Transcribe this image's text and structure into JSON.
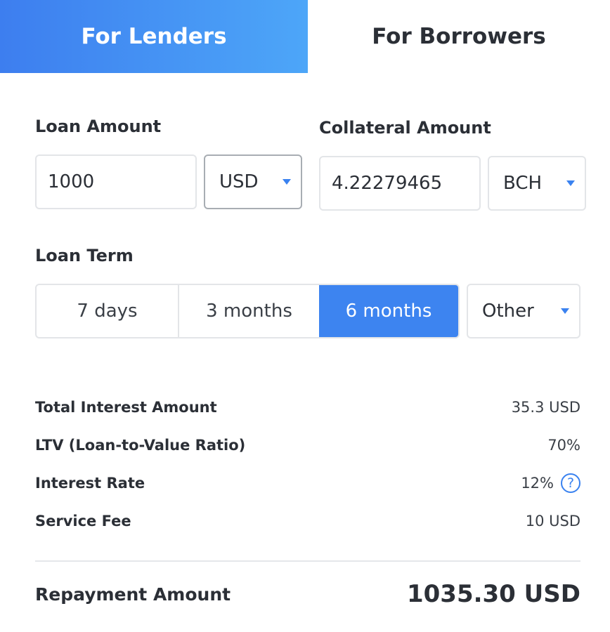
{
  "tabs": [
    {
      "label": "For Lenders",
      "active": true
    },
    {
      "label": "For Borrowers",
      "active": false
    }
  ],
  "loan_amount": {
    "label": "Loan Amount",
    "value": "1000",
    "currency": "USD"
  },
  "collateral_amount": {
    "label": "Collateral Amount",
    "value": "4.22279465",
    "currency": "BCH"
  },
  "loan_term": {
    "label": "Loan Term",
    "options": [
      "7 days",
      "3 months",
      "6 months"
    ],
    "selected": "6 months",
    "other_label": "Other"
  },
  "summary": {
    "total_interest_label": "Total Interest Amount",
    "total_interest_value": "35.3 USD",
    "ltv_label": "LTV (Loan-to-Value Ratio)",
    "ltv_value": "70%",
    "interest_rate_label": "Interest Rate",
    "interest_rate_value": "12%",
    "service_fee_label": "Service Fee",
    "service_fee_value": "10 USD",
    "help_icon_glyph": "?"
  },
  "repayment": {
    "label": "Repayment Amount",
    "value": "1035.30 USD"
  },
  "colors": {
    "accent": "#3d84f0",
    "text": "#2b2f36",
    "border": "#e3e5e8"
  }
}
